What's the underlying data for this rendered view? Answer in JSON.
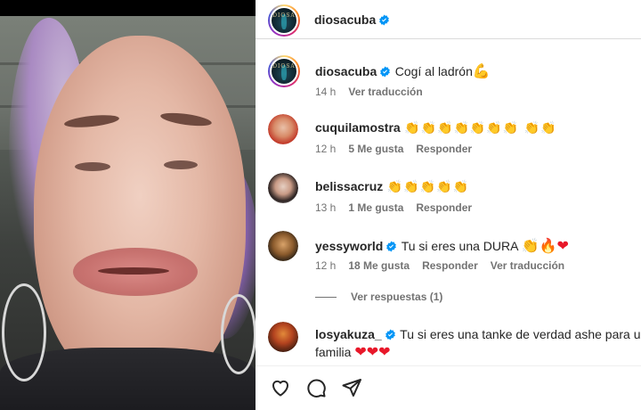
{
  "post": {
    "author": "diosacuba",
    "avatar_text": "DIOSA",
    "caption": "Cogí al ladrón",
    "caption_emoji": "💪",
    "time": "14 h",
    "see_translation": "Ver traducción"
  },
  "comments": [
    {
      "username": "cuquilamostra",
      "text": "👏👏👏👏👏👏👏 👏👏",
      "time": "12 h",
      "likes": "5 Me gusta",
      "reply": "Responder"
    },
    {
      "username": "belissacruz",
      "text": "👏👏👏👏👏",
      "time": "13 h",
      "likes": "1 Me gusta",
      "reply": "Responder"
    },
    {
      "username": "yessyworld",
      "text": "Tu si eres una DURA ",
      "emojis": "👏🔥❤",
      "time": "12 h",
      "likes": "18 Me gusta",
      "reply": "Responder",
      "translate": "Ver traducción"
    },
    {
      "username": "losyakuza_",
      "text": "Tu si eres una tanke de verdad ashe para uste",
      "text_line2": "familia ",
      "emojis": "❤❤❤"
    }
  ],
  "view_replies": "Ver respuestas (1)",
  "icons": [
    "heart-icon",
    "comment-icon",
    "share-icon",
    "verified-icon"
  ],
  "colors": {
    "verified": "#0095f6",
    "meta_text": "#737373"
  }
}
